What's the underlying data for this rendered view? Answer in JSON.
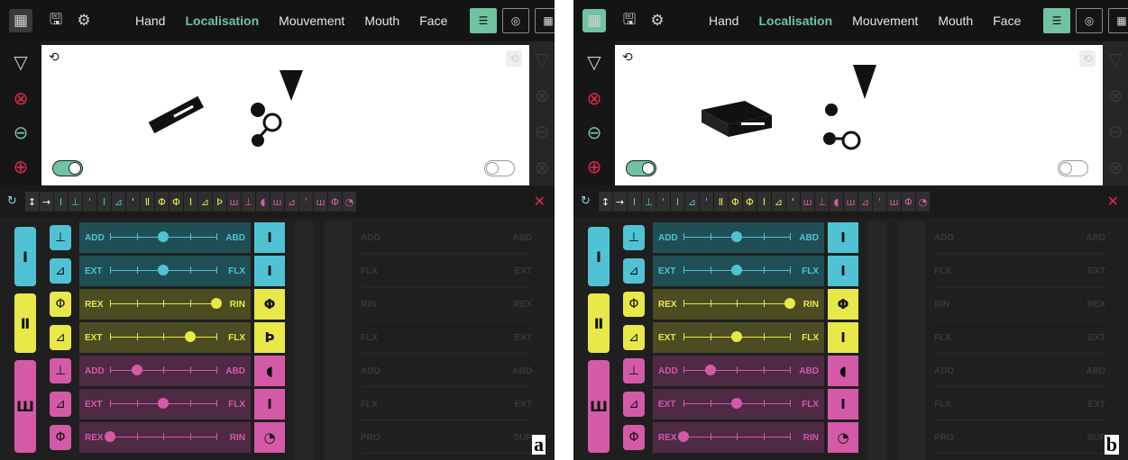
{
  "menu": [
    "Hand",
    "Localisation",
    "Mouvement",
    "Mouth",
    "Face"
  ],
  "active_menu": "Localisation",
  "colors": {
    "cyan": "#4fc3d4",
    "yellow": "#e8e84a",
    "pink": "#d45aa8",
    "accent": "#6fc3a1",
    "stop": "#e0284b",
    "cyanbg": "#1f4f55",
    "yellowbg": "#4c4c22",
    "pinkbg": "#4e2a45"
  },
  "icons": {
    "keyboard": "keyboard-icon",
    "save": "save-icon",
    "settings": "gear-icon",
    "history": "history-icon",
    "triangle": "triangle-down-icon",
    "cancel": "cancel-circle-icon",
    "exit": "exit-icon",
    "merge": "merge-exit-icon",
    "refresh": "refresh-icon",
    "clear": "close-icon"
  },
  "panels": [
    {
      "letter": "a",
      "glyphs": [
        "↕",
        "→",
        "I",
        "⊥",
        "'",
        "I",
        "⊿",
        "'",
        "Ⅱ",
        "Φ",
        "Φ",
        "I",
        "⊿",
        "Þ",
        "ш",
        "⊥",
        "◖",
        "ш",
        "⊿",
        "'",
        "ш",
        "Φ",
        "◔"
      ],
      "glyph_colors": [
        "#fff",
        "#fff",
        "#4fc3d4",
        "#4fc3d4",
        "#4fc3d4",
        "#4fc3d4",
        "#4fc3d4",
        "#e8e84a",
        "#e8e84a",
        "#e8e84a",
        "#e8e84a",
        "#e8e84a",
        "#e8e84a",
        "#e8e84a",
        "#d45aa8",
        "#d45aa8",
        "#d45aa8",
        "#d45aa8",
        "#d45aa8",
        "#d45aa8",
        "#d45aa8",
        "#d45aa8",
        "#d45aa8"
      ],
      "rows": [
        {
          "group": "cyan",
          "l": "ADD",
          "r": "ABD",
          "pos": 0.5,
          "res": "I"
        },
        {
          "group": "cyan",
          "l": "EXT",
          "r": "FLX",
          "pos": 0.5,
          "res": "I"
        },
        {
          "group": "yellow",
          "l": "REX",
          "r": "RIN",
          "pos": 1.0,
          "res": "Φ"
        },
        {
          "group": "yellow",
          "l": "EXT",
          "r": "FLX",
          "pos": 0.75,
          "res": "Þ"
        },
        {
          "group": "pink",
          "l": "ADD",
          "r": "ABD",
          "pos": 0.25,
          "res": "◖"
        },
        {
          "group": "pink",
          "l": "EXT",
          "r": "FLX",
          "pos": 0.5,
          "res": "I"
        },
        {
          "group": "pink",
          "l": "REX",
          "r": "RIN",
          "pos": 0.0,
          "res": "◔"
        }
      ]
    },
    {
      "letter": "b",
      "glyphs": [
        "↕",
        "→",
        "I",
        "⊥",
        "'",
        "I",
        "⊿",
        "'",
        "Ⅱ",
        "Φ",
        "Φ",
        "I",
        "⊿",
        "'",
        "ш",
        "⊥",
        "◖",
        "ш",
        "⊿",
        "'",
        "ш",
        "Φ",
        "◔"
      ],
      "glyph_colors": [
        "#fff",
        "#fff",
        "#4fc3d4",
        "#4fc3d4",
        "#4fc3d4",
        "#4fc3d4",
        "#4fc3d4",
        "#4fc3d4",
        "#e8e84a",
        "#e8e84a",
        "#e8e84a",
        "#e8e84a",
        "#e8e84a",
        "#e8e84a",
        "#d45aa8",
        "#d45aa8",
        "#d45aa8",
        "#d45aa8",
        "#d45aa8",
        "#d45aa8",
        "#d45aa8",
        "#d45aa8",
        "#d45aa8"
      ],
      "rows": [
        {
          "group": "cyan",
          "l": "ADD",
          "r": "ABD",
          "pos": 0.5,
          "res": "I"
        },
        {
          "group": "cyan",
          "l": "EXT",
          "r": "FLX",
          "pos": 0.5,
          "res": "I"
        },
        {
          "group": "yellow",
          "l": "REX",
          "r": "RIN",
          "pos": 1.0,
          "res": "Φ"
        },
        {
          "group": "yellow",
          "l": "EXT",
          "r": "FLX",
          "pos": 0.5,
          "res": "I"
        },
        {
          "group": "pink",
          "l": "ADD",
          "r": "ABD",
          "pos": 0.25,
          "res": "◖"
        },
        {
          "group": "pink",
          "l": "EXT",
          "r": "FLX",
          "pos": 0.5,
          "res": "I"
        },
        {
          "group": "pink",
          "l": "REX",
          "r": "RIN",
          "pos": 0.0,
          "res": "◔"
        }
      ]
    }
  ],
  "hands": [
    {
      "label": "I",
      "group": "cyan"
    },
    {
      "label": "Ⅱ",
      "group": "yellow"
    },
    {
      "label": "Ш",
      "group": "pink"
    }
  ],
  "ghost_rows": [
    {
      "l": "ADD",
      "r": "ABD"
    },
    {
      "l": "FLX",
      "r": "EXT"
    },
    {
      "l": "RIN",
      "r": "REX"
    },
    {
      "l": "FLX",
      "r": "EXT"
    },
    {
      "l": "ADD",
      "r": "ABD"
    },
    {
      "l": "FLX",
      "r": "EXT"
    },
    {
      "l": "PRO",
      "r": "SUP"
    }
  ]
}
